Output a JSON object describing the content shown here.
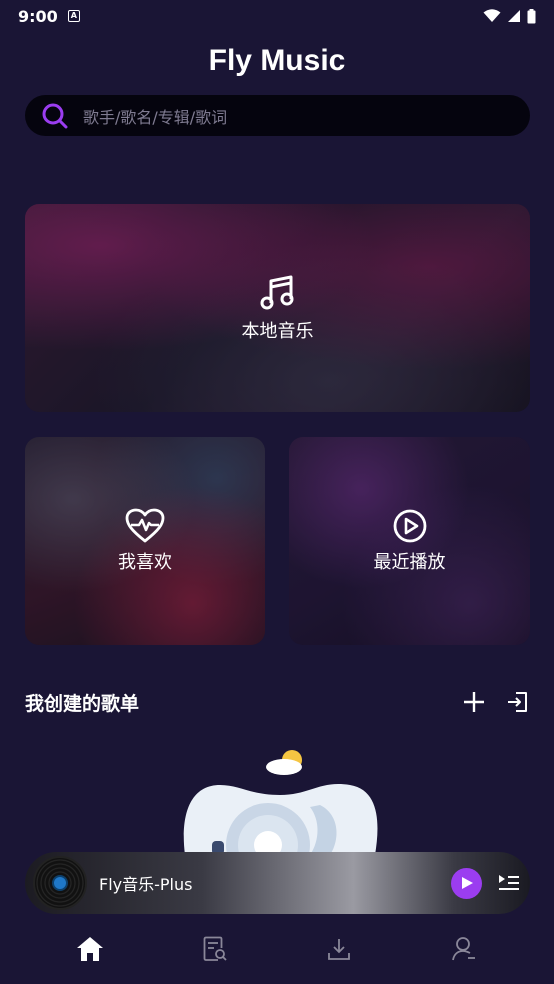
{
  "status_bar": {
    "time": "9:00",
    "notification_icon": "a-icon",
    "wifi_icon": "wifi-icon",
    "signal_icon": "signal-icon",
    "battery_icon": "battery-icon"
  },
  "header": {
    "title": "Fly Music"
  },
  "search": {
    "placeholder": "歌手/歌名/专辑/歌词",
    "icon": "search-icon",
    "accent_color": "#9b3df0"
  },
  "cards": {
    "local": {
      "label": "本地音乐",
      "icon": "music-note-icon"
    },
    "favorites": {
      "label": "我喜欢",
      "icon": "heart-pulse-icon"
    },
    "recent": {
      "label": "最近播放",
      "icon": "play-circle-icon"
    }
  },
  "playlists": {
    "title": "我创建的歌单",
    "add_icon": "plus-icon",
    "import_icon": "import-icon"
  },
  "player": {
    "track": "Fly音乐-Plus",
    "play_icon": "play-icon",
    "queue_icon": "playlist-icon"
  },
  "nav": {
    "items": [
      {
        "icon": "home-icon",
        "active": true
      },
      {
        "icon": "search-list-icon",
        "active": false
      },
      {
        "icon": "download-icon",
        "active": false
      },
      {
        "icon": "profile-icon",
        "active": false
      }
    ]
  },
  "colors": {
    "background": "#1a1535",
    "accent": "#9b3df0",
    "active_nav": "#ffffff",
    "inactive_nav": "#8a8799"
  }
}
